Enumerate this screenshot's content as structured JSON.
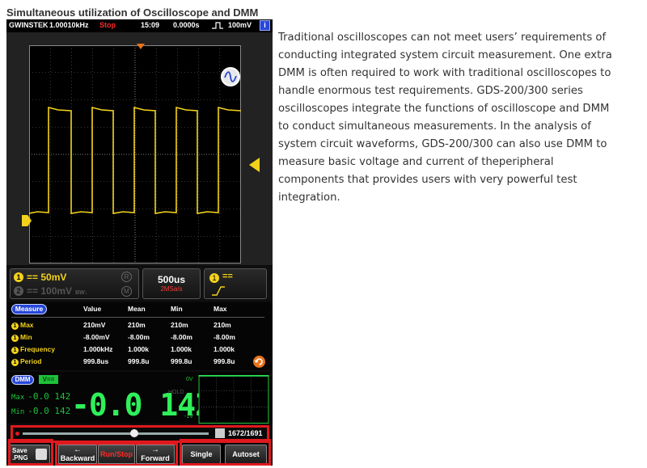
{
  "heading": "Simultaneous utilization of Oscilloscope and DMM",
  "description": "Traditional oscilloscopes can not meet users’ requirements of conducting integrated system circuit measurement. One extra DMM is often required to work with traditional oscilloscopes to handle enormous test requirements. GDS-200/300 series oscilloscopes integrate the functions of oscilloscope and DMM to conduct simultaneous measurements. In the analysis of system circuit waveforms, GDS-200/300 can also use DMM to measure basic voltage and current of theperipheral components that provides users with very powerful test integration.",
  "device": {
    "status_bar": {
      "brand": "GWINSTEK",
      "frequency": "1.00010kHz",
      "run_state": "Stop",
      "time": "15:09",
      "position": "0.0000s",
      "trigger_icon": "rising-edge-icon",
      "trigger_level": "100mV",
      "info_label": "i"
    },
    "channels": {
      "ch1_number": "1",
      "ch1_scale": "50mV",
      "ch2_number": "2",
      "ch2_scale": "100mV",
      "ch2_bw": "BW↓",
      "r_label": "R",
      "m_label": "M"
    },
    "timebase": {
      "time_div": "500us",
      "sample_rate": "2MSa/s"
    },
    "trigger_panel": {
      "source": "1"
    },
    "measure": {
      "header_label": "Measure",
      "columns": [
        "Value",
        "Mean",
        "Min",
        "Max"
      ],
      "rows": [
        {
          "num": "1",
          "label": "Max",
          "value": "210mV",
          "mean": "210m",
          "min": "210m",
          "max": "210m"
        },
        {
          "num": "1",
          "label": "Min",
          "value": "-8.00mV",
          "mean": "-8.00m",
          "min": "-8.00m",
          "max": "-8.00m"
        },
        {
          "num": "1",
          "label": "Frequency",
          "value": "1.000kHz",
          "mean": "1.000k",
          "min": "1.000k",
          "max": "1.000k"
        },
        {
          "num": "1",
          "label": "Period",
          "value": "999.8us",
          "mean": "999.8u",
          "min": "999.8u",
          "max": "999.8u"
        }
      ]
    },
    "dmm": {
      "label": "DMM",
      "mode": "V==",
      "max_label": "Max",
      "max_value": "-0.0 142",
      "min_label": "Min",
      "min_value": "-0.0 142",
      "reading": "-0.0 142",
      "hold": "HOLD",
      "mini_top": "0V",
      "mini_bottom": "-1V"
    },
    "position_bar": {
      "counter": "1672/1691",
      "fraction": 0.6
    },
    "buttons": {
      "save_line1": "Save",
      "save_line2": ".PNG",
      "backward_arrow": "←",
      "backward": "Backward",
      "run_stop": "Run/Stop",
      "forward_arrow": "→",
      "forward": "Forward",
      "single": "Single",
      "autoset": "Autoset"
    },
    "colors": {
      "trace": "#f3d21b",
      "dmm": "#2ff05a",
      "highlight": "#e0191e",
      "accent": "#2747d8"
    }
  }
}
